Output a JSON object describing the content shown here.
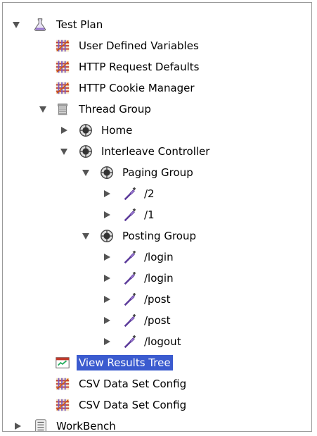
{
  "tree": {
    "test_plan": "Test Plan",
    "user_defined_variables": "User Defined Variables",
    "http_request_defaults": "HTTP Request Defaults",
    "http_cookie_manager": "HTTP Cookie Manager",
    "thread_group": "Thread Group",
    "home": "Home",
    "interleave_controller": "Interleave Controller",
    "paging_group": "Paging Group",
    "paging_2": "/2",
    "paging_1": "/1",
    "posting_group": "Posting Group",
    "login_1": "/login",
    "login_2": "/login",
    "post_1": "/post",
    "post_2": "/post",
    "logout": "/logout",
    "view_results_tree": "View Results Tree",
    "csv_data_set_config_1": "CSV Data Set Config",
    "csv_data_set_config_2": "CSV Data Set Config",
    "workbench": "WorkBench"
  },
  "selected_item": "View Results Tree",
  "colors": {
    "selection": "#3b5bcf",
    "config_icon": "#c0392b",
    "sampler_icon": "#7a4bb3"
  }
}
